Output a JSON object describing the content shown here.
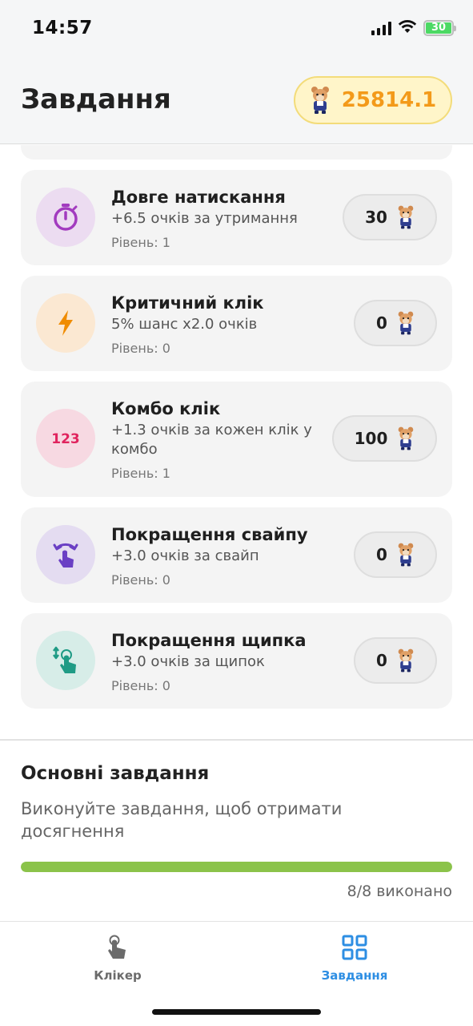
{
  "status_bar": {
    "time": "14:57",
    "battery": "30"
  },
  "header": {
    "title": "Завдання",
    "balance": "25814.1",
    "balance_icon": "hamster-coin-icon"
  },
  "upgrades": [
    {
      "title": "Довге натискання",
      "description": "+6.5 очків за утримання",
      "level": "Рівень: 1",
      "cost": "30",
      "icon": "stopwatch-icon",
      "icon_bg": "#ecdcf1",
      "icon_color": "#a23bbf"
    },
    {
      "title": "Критичний клік",
      "description": "5% шанс x2.0 очків",
      "level": "Рівень: 0",
      "cost": "0",
      "icon": "lightning-icon",
      "icon_bg": "#fbe8d2",
      "icon_color": "#f08c00"
    },
    {
      "title": "Комбо клік",
      "description": "+1.3 очків за кожен клік у комбо",
      "level": "Рівень: 1",
      "cost": "100",
      "icon": "numbers-123-icon",
      "icon_bg": "#f7d9e2",
      "icon_color": "#e0245e"
    },
    {
      "title": "Покращення свайпу",
      "description": "+3.0 очків за свайп",
      "level": "Рівень: 0",
      "cost": "0",
      "icon": "swipe-gesture-icon",
      "icon_bg": "#e4dcf1",
      "icon_color": "#6a3fc4"
    },
    {
      "title": "Покращення щипка",
      "description": "+3.0 очків за щипок",
      "level": "Рівень: 0",
      "cost": "0",
      "icon": "pinch-gesture-icon",
      "icon_bg": "#d7ede8",
      "icon_color": "#1f9b85"
    }
  ],
  "main_tasks": {
    "title": "Основні завдання",
    "description": "Виконуйте завдання, щоб отримати досягнення",
    "progress_fraction": 1.0,
    "progress_text": "8/8 виконано",
    "progress_color": "#8bc34a"
  },
  "bottom_nav": {
    "items": [
      {
        "label": "Клікер",
        "icon": "tap-hand-icon",
        "active": false
      },
      {
        "label": "Завдання",
        "icon": "grid-icon",
        "active": true
      }
    ],
    "active_color": "#2d8ee3",
    "inactive_color": "#6b6b6b"
  }
}
